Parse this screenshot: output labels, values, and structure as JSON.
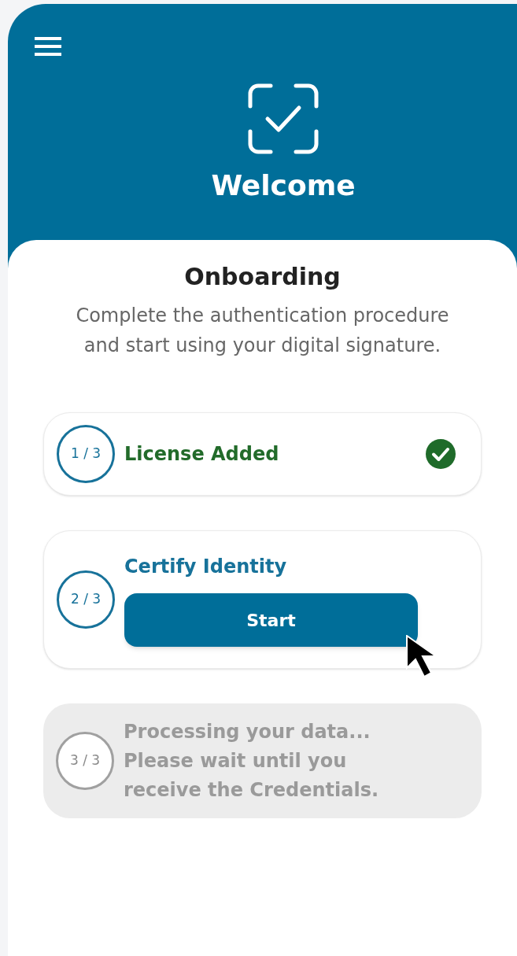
{
  "header": {
    "title": "Welcome"
  },
  "onboarding": {
    "title": "Onboarding",
    "description": "Complete the authentication procedure and start using your digital signature."
  },
  "steps": [
    {
      "kind": "done",
      "counter": "1 / 3",
      "title": "License Added"
    },
    {
      "kind": "active",
      "counter": "2 / 3",
      "title": "Certify Identity",
      "button": "Start"
    },
    {
      "kind": "pending",
      "counter": "3 / 3",
      "title": "Processing your data... Please wait until you receive the Credentials."
    }
  ]
}
